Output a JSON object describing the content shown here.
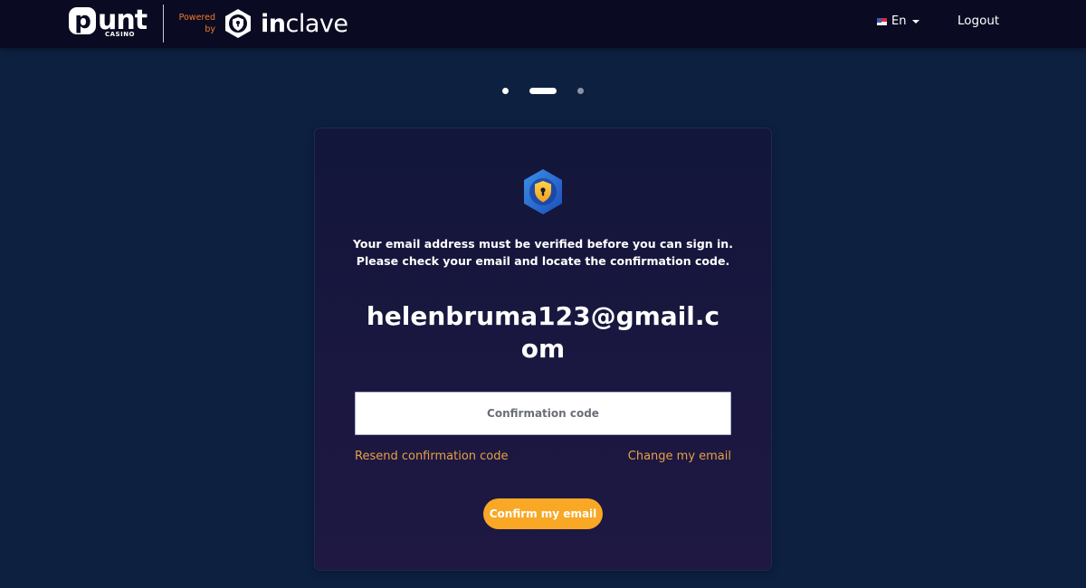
{
  "header": {
    "brand": {
      "punt_logo": "punt",
      "punt_sub": "CASINO",
      "powered_by": [
        "Powered",
        "by"
      ],
      "partner_prefix": "in",
      "partner_suffix": "clave",
      "partner_icon": "inclave-shield-icon"
    },
    "language": {
      "flag_icon": "us-flag-icon",
      "selected": "En"
    },
    "logout_label": "Logout"
  },
  "stepper": {
    "total_steps": 3,
    "current_step": 2
  },
  "card": {
    "icon": "shield-lock-icon",
    "message_line1": "Your email address must be verified before you can sign in.",
    "message_line2": "Please check your email and locate the confirmation code.",
    "email": "helenbruma123@gmail.com",
    "code_input": {
      "value": "",
      "placeholder": "Confirmation code"
    },
    "resend_link": "Resend confirmation code",
    "change_email_link": "Change my email",
    "confirm_button": "Confirm my email"
  },
  "colors": {
    "accent": "#f9a825",
    "link": "#e8a045",
    "powered_by": "#f0792a",
    "page_bg": "#0d2040",
    "header_bg": "#0a0b22",
    "card_bg": "#16173d"
  }
}
